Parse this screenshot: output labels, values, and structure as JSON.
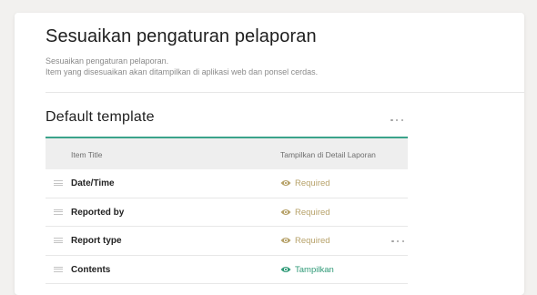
{
  "page": {
    "title": "Sesuaikan pengaturan pelaporan",
    "description_line1": "Sesuaikan pengaturan pelaporan.",
    "description_line2": "Item yang disesuaikan akan ditampilkan di aplikasi web dan ponsel cerdas."
  },
  "template": {
    "title": "Default template",
    "more_icon": "more-horizontal-icon"
  },
  "table": {
    "headers": {
      "item_title": "Item Title",
      "display": "Tampilkan di Detail Laporan"
    },
    "rows": [
      {
        "title": "Date/Time",
        "status": "Required",
        "status_type": "required"
      },
      {
        "title": "Reported by",
        "status": "Required",
        "status_type": "required"
      },
      {
        "title": "Report type",
        "status": "Required",
        "status_type": "required",
        "has_menu": true
      },
      {
        "title": "Contents",
        "status": "Tampilkan",
        "status_type": "shown"
      }
    ]
  },
  "colors": {
    "accent": "#3aa38a",
    "required": "#b7a26a",
    "shown": "#2f9a77"
  }
}
